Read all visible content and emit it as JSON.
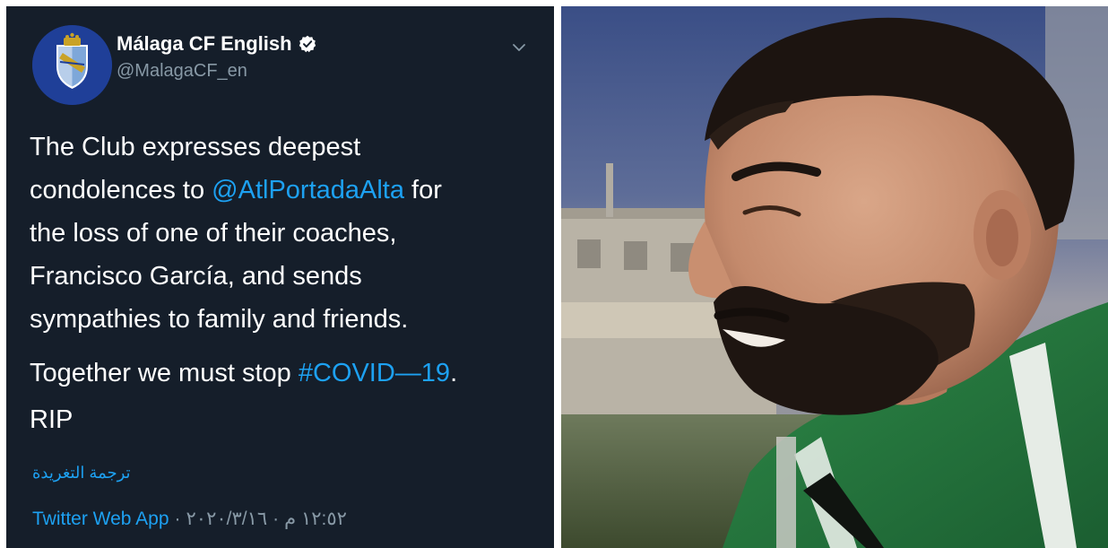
{
  "tweet": {
    "author_name": "Málaga CF English",
    "author_handle": "@MalagaCF_en",
    "verified": true,
    "text_lines": [
      "The Club expresses deepest",
      "condolences to ",
      "@AtlPortadaAlta",
      " for",
      "the loss of one of their coaches,",
      "Francisco García, and sends",
      "sympathies to family and friends."
    ],
    "together_text": "Together we must stop ",
    "hashtag": "#COVID—19",
    "together_end": ".",
    "rip": "RIP",
    "translate_label": "ترجمة التغريدة",
    "source": "Twitter Web App",
    "separator": "·",
    "date": "٢٠٢٠/٣/١٦",
    "time": "١٢:٥٢ م"
  },
  "icons": {
    "avatar": "malaga-crest-icon",
    "verified": "verified-badge-icon",
    "menu": "chevron-down-icon"
  },
  "colors": {
    "background": "#151e2a",
    "link": "#1da1f2",
    "secondary_text": "#8899a6",
    "avatar_bg": "#1f3f98"
  },
  "photo": {
    "subject": "smiling bearded man in green and white jersey"
  }
}
